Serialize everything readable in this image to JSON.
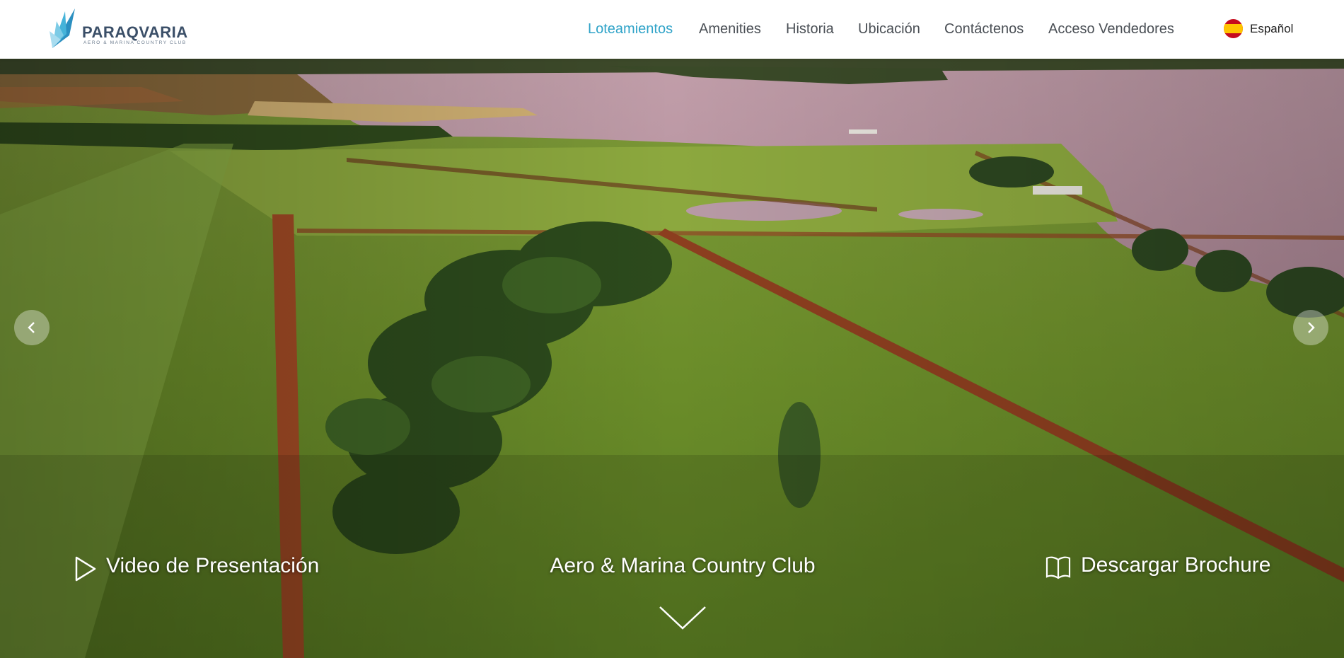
{
  "brand": {
    "name": "PARAQVARIA",
    "tagline": "AERO & MARINA COUNTRY CLUB",
    "logo_icon": "feather-fan-icon",
    "color": "#2fa3c8"
  },
  "nav": {
    "items": [
      {
        "label": "Loteamientos",
        "active": true
      },
      {
        "label": "Amenities"
      },
      {
        "label": "Historia"
      },
      {
        "label": "Ubicación"
      },
      {
        "label": "Contáctenos"
      },
      {
        "label": "Acceso Vendedores"
      }
    ],
    "active_color": "#2fa3c8",
    "language": {
      "label": "Español",
      "icon": "spain-flag-icon"
    }
  },
  "hero": {
    "video_label": "Video de Presentación",
    "video_icon": "play-icon",
    "title": "Aero & Marina Country Club",
    "brochure_label": "Descargar Brochure",
    "brochure_icon": "book-icon",
    "prev_icon": "chevron-left-icon",
    "next_icon": "chevron-right-icon",
    "scroll_icon": "chevron-down-icon"
  }
}
